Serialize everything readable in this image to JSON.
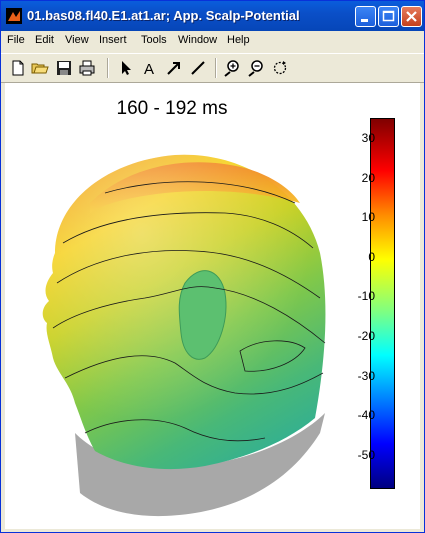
{
  "window": {
    "title": "01.bas08.fl40.E1.at1.ar; App. Scalp-Potential"
  },
  "menu": [
    "File",
    "Edit",
    "View",
    "Insert",
    "Tools",
    "Window",
    "Help"
  ],
  "toolbar": [
    "new-file-icon",
    "open-folder-icon",
    "save-icon",
    "print-icon",
    "pointer-icon",
    "text-icon",
    "arrow-icon",
    "line-icon",
    "zoom-in-icon",
    "zoom-out-icon",
    "rotate-icon"
  ],
  "figure": {
    "title": "160 - 192 ms"
  },
  "colorbar": {
    "ticks": [
      "30",
      "20",
      "10",
      "0",
      "-10",
      "-20",
      "-30",
      "-40",
      "-50"
    ]
  }
}
